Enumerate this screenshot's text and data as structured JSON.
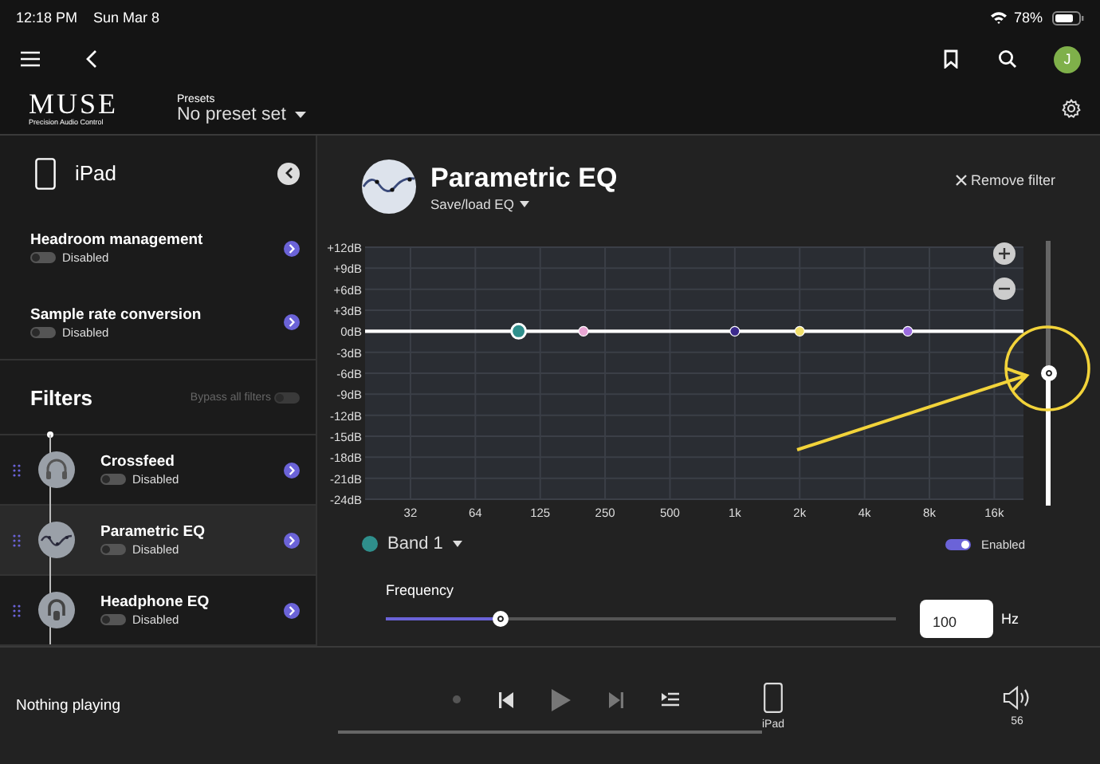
{
  "status_bar": {
    "time": "12:18 PM",
    "date": "Sun Mar 8",
    "battery": "78%"
  },
  "toolbar": {
    "avatar": "J"
  },
  "header": {
    "logo": "MUSE",
    "logo_tagline": "Precision Audio Control",
    "presets_label": "Presets",
    "preset": "No preset set"
  },
  "sidebar": {
    "device": "iPad",
    "settings": [
      {
        "name": "Headroom management",
        "on": false,
        "status": "Disabled"
      },
      {
        "name": "Sample rate conversion",
        "on": false,
        "status": "Disabled"
      }
    ],
    "filters_title": "Filters",
    "bypass": {
      "label": "Bypass all filters",
      "on": false
    },
    "filters": [
      {
        "name": "Crossfeed",
        "kind": "crossfeed",
        "on": false,
        "status": "Disabled",
        "selected": false
      },
      {
        "name": "Parametric EQ",
        "kind": "peq",
        "on": false,
        "status": "Disabled",
        "selected": true
      },
      {
        "name": "Headphone EQ",
        "kind": "headphone",
        "on": false,
        "status": "Disabled",
        "selected": false
      }
    ]
  },
  "filter_panel": {
    "title": "Parametric EQ",
    "save_load": "Save/load EQ",
    "remove": "Remove filter",
    "chart_data": {
      "type": "scatter",
      "grid": true,
      "ylim": [
        -24,
        12
      ],
      "categories": [
        "32",
        null,
        null,
        "64",
        null,
        null,
        "125",
        null,
        null,
        "250",
        null,
        null,
        "500",
        null,
        null,
        "1k",
        null,
        null,
        "2k",
        null,
        null,
        "4k",
        null,
        null,
        "8k",
        null,
        null,
        "16k"
      ],
      "yticks": [
        {
          "value": 12,
          "label": "+12dB"
        },
        {
          "value": 9,
          "label": "+9dB"
        },
        {
          "value": 6,
          "label": "+6dB"
        },
        {
          "value": 3,
          "label": "+3dB"
        },
        {
          "value": 0,
          "label": "0dB"
        },
        {
          "value": -3,
          "label": "-3dB"
        },
        {
          "value": -6,
          "label": "-6dB"
        },
        {
          "value": -9,
          "label": "-9dB"
        },
        {
          "value": -12,
          "label": "-12dB"
        },
        {
          "value": -15,
          "label": "-15dB"
        },
        {
          "value": -18,
          "label": "-18dB"
        },
        {
          "value": -21,
          "label": "-21dB"
        },
        {
          "value": -24,
          "label": "-24dB"
        }
      ],
      "series": [
        {
          "color": "#2f8f8c",
          "values": [
            null,
            null,
            null,
            null,
            null,
            0,
            null,
            null,
            null,
            null,
            null,
            null,
            null,
            null,
            null,
            null,
            null,
            null,
            null,
            null,
            null,
            null,
            null,
            null,
            null,
            null,
            null,
            null
          ]
        },
        {
          "color": "#e8a6d4",
          "values": [
            null,
            null,
            null,
            null,
            null,
            null,
            null,
            null,
            0,
            null,
            null,
            null,
            null,
            null,
            null,
            null,
            null,
            null,
            null,
            null,
            null,
            null,
            null,
            null,
            null,
            null,
            null,
            null
          ]
        },
        {
          "color": "#3b2a8c",
          "values": [
            null,
            null,
            null,
            null,
            null,
            null,
            null,
            null,
            null,
            null,
            null,
            null,
            null,
            null,
            null,
            0,
            null,
            null,
            null,
            null,
            null,
            null,
            null,
            null,
            null,
            null,
            null,
            null
          ]
        },
        {
          "color": "#f2e06b",
          "values": [
            null,
            null,
            null,
            null,
            null,
            null,
            null,
            null,
            null,
            null,
            null,
            null,
            null,
            null,
            null,
            null,
            null,
            null,
            0,
            null,
            null,
            null,
            null,
            null,
            null,
            null,
            null,
            null
          ]
        },
        {
          "color": "#9b6be0",
          "values": [
            null,
            null,
            null,
            null,
            null,
            null,
            null,
            null,
            null,
            null,
            null,
            null,
            null,
            null,
            null,
            null,
            null,
            null,
            null,
            null,
            null,
            null,
            null,
            0,
            null,
            null,
            null,
            null
          ]
        }
      ]
    },
    "gain_slider": {
      "level": 0.5
    },
    "band": {
      "name": "Band 1",
      "color": "#2f8f8c",
      "enabled": true,
      "enabled_label": "Enabled"
    },
    "frequency": {
      "label": "Frequency",
      "level": 0.225,
      "value": "100",
      "unit": "Hz"
    }
  },
  "player": {
    "status": "Nothing playing",
    "output": "iPad",
    "volume": "56"
  }
}
